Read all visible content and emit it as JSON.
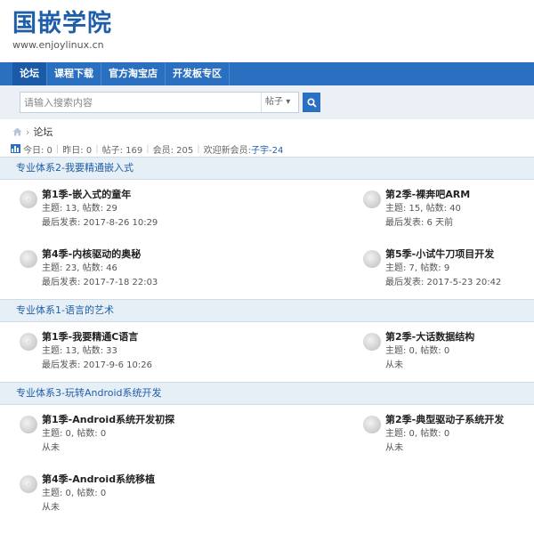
{
  "site": {
    "title": "国嵌学院",
    "url": "www.enjoylinux.cn"
  },
  "nav": [
    "论坛",
    "课程下载",
    "官方淘宝店",
    "开发板专区"
  ],
  "search": {
    "placeholder": "请输入搜索内容",
    "type": "帖子",
    "type_arrow": "▾"
  },
  "breadcrumb": {
    "current": "论坛"
  },
  "stats": {
    "today": "今日: 0",
    "yesterday": "昨日: 0",
    "posts": "帖子: 169",
    "members": "会员: 205",
    "welcome": "欢迎新会员:",
    "newest": "子宇-24"
  },
  "categories": [
    {
      "name": "专业体系2-我要精通嵌入式",
      "forums": [
        {
          "title": "第1季-嵌入式的童年",
          "stats": "主题: 13, 帖数: 29",
          "last": "最后发表: 2017-8-26 10:29"
        },
        {
          "title": "第2季-裸奔吧ARM",
          "stats": "主题: 15, 帖数: 40",
          "last": "最后发表: 6 天前"
        },
        {
          "title": "第4季-内核驱动的奥秘",
          "stats": "主题: 23, 帖数: 46",
          "last": "最后发表: 2017-7-18 22:03"
        },
        {
          "title": "第5季-小试牛刀项目开发",
          "stats": "主题: 7, 帖数: 9",
          "last": "最后发表: 2017-5-23 20:42"
        }
      ]
    },
    {
      "name": "专业体系1-语言的艺术",
      "forums": [
        {
          "title": "第1季-我要精通C语言",
          "stats": "主题: 13, 帖数: 33",
          "last": "最后发表: 2017-9-6 10:26"
        },
        {
          "title": "第2季-大话数据结构",
          "stats": "主题: 0, 帖数: 0",
          "last": "从未"
        }
      ]
    },
    {
      "name": "专业体系3-玩转Android系统开发",
      "forums": [
        {
          "title": "第1季-Android系统开发初探",
          "stats": "主题: 0, 帖数: 0",
          "last": "从未"
        },
        {
          "title": "第2季-典型驱动子系统开发",
          "stats": "主题: 0, 帖数: 0",
          "last": "从未"
        },
        {
          "title": "第4季-Android系统移植",
          "stats": "主题: 0, 帖数: 0",
          "last": "从未"
        }
      ]
    }
  ]
}
